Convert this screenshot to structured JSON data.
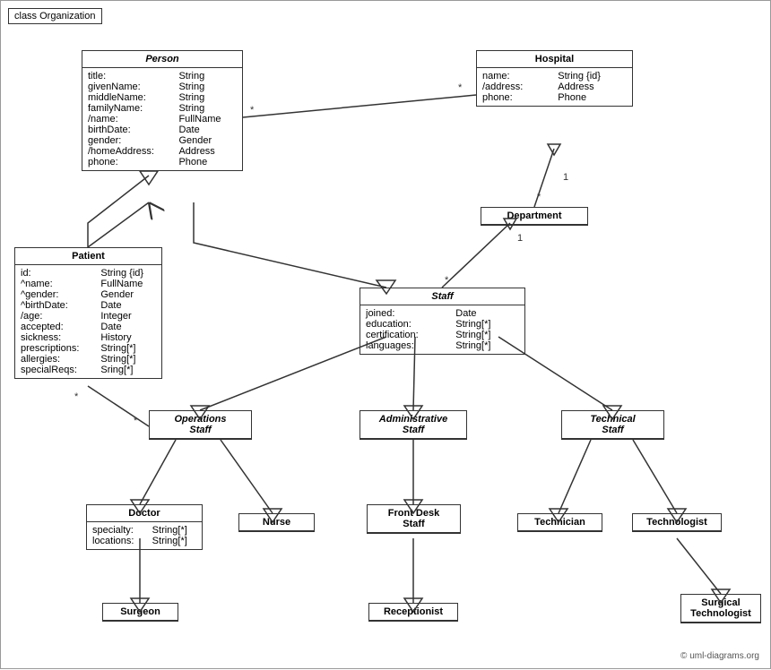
{
  "title": "class Organization",
  "copyright": "© uml-diagrams.org",
  "classes": {
    "person": {
      "name": "Person",
      "italic": true,
      "attrs": [
        {
          "name": "title:",
          "type": "String"
        },
        {
          "name": "givenName:",
          "type": "String"
        },
        {
          "name": "middleName:",
          "type": "String"
        },
        {
          "name": "familyName:",
          "type": "String"
        },
        {
          "name": "/name:",
          "type": "FullName"
        },
        {
          "name": "birthDate:",
          "type": "Date"
        },
        {
          "name": "gender:",
          "type": "Gender"
        },
        {
          "name": "/homeAddress:",
          "type": "Address"
        },
        {
          "name": "phone:",
          "type": "Phone"
        }
      ]
    },
    "hospital": {
      "name": "Hospital",
      "italic": false,
      "attrs": [
        {
          "name": "name:",
          "type": "String {id}"
        },
        {
          "name": "/address:",
          "type": "Address"
        },
        {
          "name": "phone:",
          "type": "Phone"
        }
      ]
    },
    "department": {
      "name": "Department",
      "italic": false,
      "attrs": []
    },
    "staff": {
      "name": "Staff",
      "italic": true,
      "attrs": [
        {
          "name": "joined:",
          "type": "Date"
        },
        {
          "name": "education:",
          "type": "String[*]"
        },
        {
          "name": "certification:",
          "type": "String[*]"
        },
        {
          "name": "languages:",
          "type": "String[*]"
        }
      ]
    },
    "patient": {
      "name": "Patient",
      "italic": false,
      "attrs": [
        {
          "name": "id:",
          "type": "String {id}"
        },
        {
          "name": "^name:",
          "type": "FullName"
        },
        {
          "name": "^gender:",
          "type": "Gender"
        },
        {
          "name": "^birthDate:",
          "type": "Date"
        },
        {
          "name": "/age:",
          "type": "Integer"
        },
        {
          "name": "accepted:",
          "type": "Date"
        },
        {
          "name": "sickness:",
          "type": "History"
        },
        {
          "name": "prescriptions:",
          "type": "String[*]"
        },
        {
          "name": "allergies:",
          "type": "String[*]"
        },
        {
          "name": "specialReqs:",
          "type": "Sring[*]"
        }
      ]
    },
    "ops_staff": {
      "name": "Operations\nStaff",
      "italic": true,
      "attrs": []
    },
    "admin_staff": {
      "name": "Administrative\nStaff",
      "italic": true,
      "attrs": []
    },
    "tech_staff": {
      "name": "Technical\nStaff",
      "italic": true,
      "attrs": []
    },
    "doctor": {
      "name": "Doctor",
      "italic": false,
      "attrs": [
        {
          "name": "specialty:",
          "type": "String[*]"
        },
        {
          "name": "locations:",
          "type": "String[*]"
        }
      ]
    },
    "nurse": {
      "name": "Nurse",
      "italic": false,
      "attrs": []
    },
    "front_desk": {
      "name": "Front Desk\nStaff",
      "italic": false,
      "attrs": []
    },
    "technician": {
      "name": "Technician",
      "italic": false,
      "attrs": []
    },
    "technologist": {
      "name": "Technologist",
      "italic": false,
      "attrs": []
    },
    "surgeon": {
      "name": "Surgeon",
      "italic": false,
      "attrs": []
    },
    "receptionist": {
      "name": "Receptionist",
      "italic": false,
      "attrs": []
    },
    "surgical_tech": {
      "name": "Surgical\nTechnologist",
      "italic": false,
      "attrs": []
    }
  }
}
